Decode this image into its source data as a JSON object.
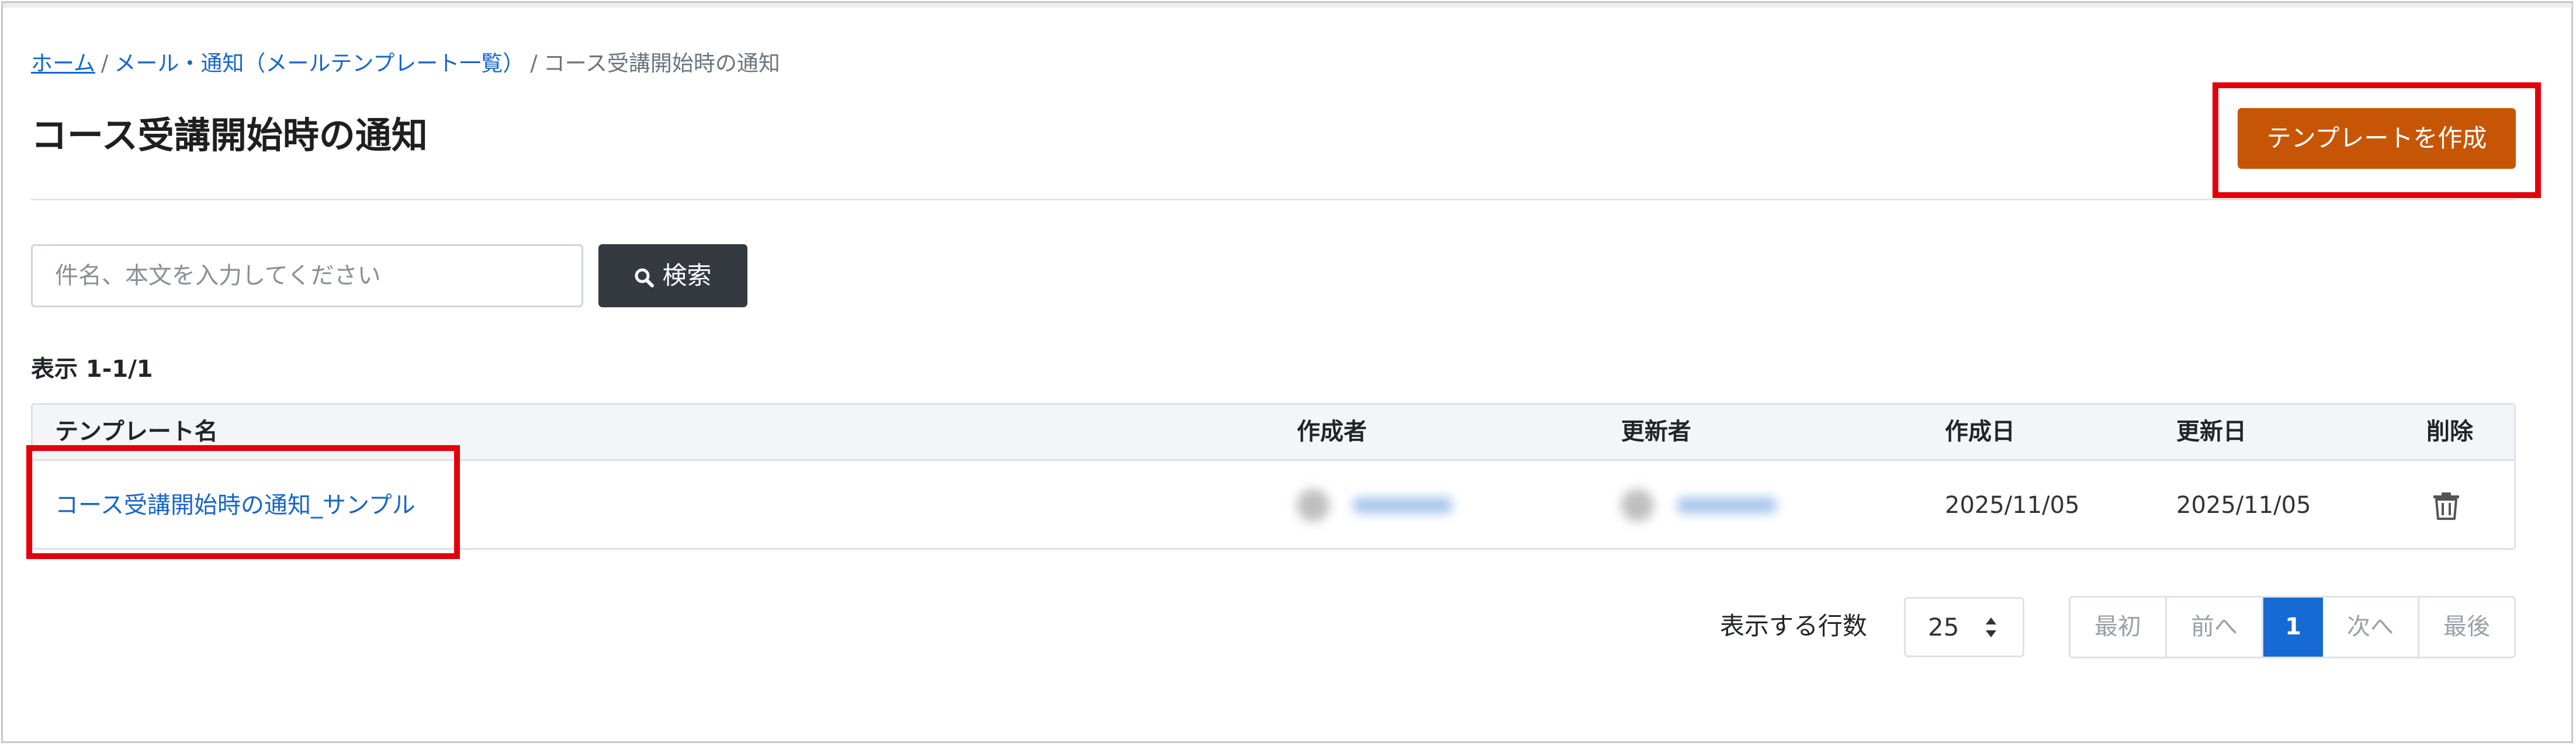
{
  "breadcrumb": {
    "home": "ホーム",
    "separator": "/",
    "parent": "メール・通知（メールテンプレート一覧）",
    "current": "コース受講開始時の通知"
  },
  "page": {
    "title": "コース受講開始時の通知"
  },
  "toolbar": {
    "create_label": "テンプレートを作成"
  },
  "search": {
    "placeholder": "件名、本文を入力してください",
    "value": "",
    "button_label": "検索",
    "icon": "search-icon"
  },
  "results": {
    "count_label": "表示 1-1/1"
  },
  "table": {
    "columns": {
      "name": "テンプレート名",
      "creator": "作成者",
      "updater": "更新者",
      "created": "作成日",
      "updated": "更新日",
      "delete": "削除"
    },
    "rows": [
      {
        "name": "コース受講開始時の通知_サンプル",
        "created": "2025/11/05",
        "updated": "2025/11/05",
        "delete_icon": "trash-icon"
      }
    ]
  },
  "pagination": {
    "rows_label": "表示する行数",
    "rows_value": "25",
    "first": "最初",
    "prev": "前へ",
    "current": "1",
    "next": "次へ",
    "last": "最後"
  },
  "colors": {
    "accent_button": "#c65605",
    "link": "#1766c8",
    "search_button": "#343a40",
    "active_page": "#1769d3",
    "highlight_box": "#e4000b"
  }
}
